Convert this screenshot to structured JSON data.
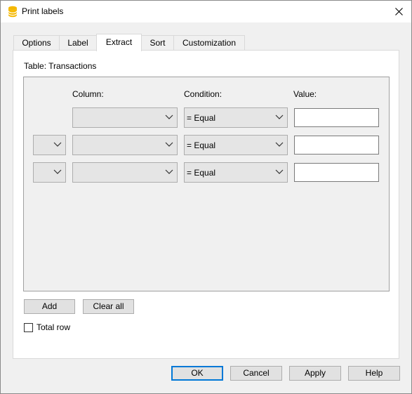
{
  "window": {
    "title": "Print labels",
    "close_symbol": "✕"
  },
  "tabs": [
    {
      "label": "Options",
      "active": false
    },
    {
      "label": "Label",
      "active": false
    },
    {
      "label": "Extract",
      "active": true
    },
    {
      "label": "Sort",
      "active": false
    },
    {
      "label": "Customization",
      "active": false
    }
  ],
  "extract": {
    "table_label": "Table: Transactions",
    "headers": {
      "column": "Column:",
      "condition": "Condition:",
      "value": "Value:"
    },
    "rows": [
      {
        "operator": "",
        "column": "",
        "condition": "= Equal",
        "value": ""
      },
      {
        "operator": "",
        "column": "",
        "condition": "= Equal",
        "value": ""
      },
      {
        "operator": "",
        "column": "",
        "condition": "= Equal",
        "value": ""
      }
    ],
    "add_label": "Add",
    "clear_all_label": "Clear all",
    "total_row_label": "Total row",
    "total_row_checked": false
  },
  "footer": {
    "ok": "OK",
    "cancel": "Cancel",
    "apply": "Apply",
    "help": "Help"
  },
  "colors": {
    "accent": "#0078d7",
    "app_icon": "#f5b800"
  }
}
